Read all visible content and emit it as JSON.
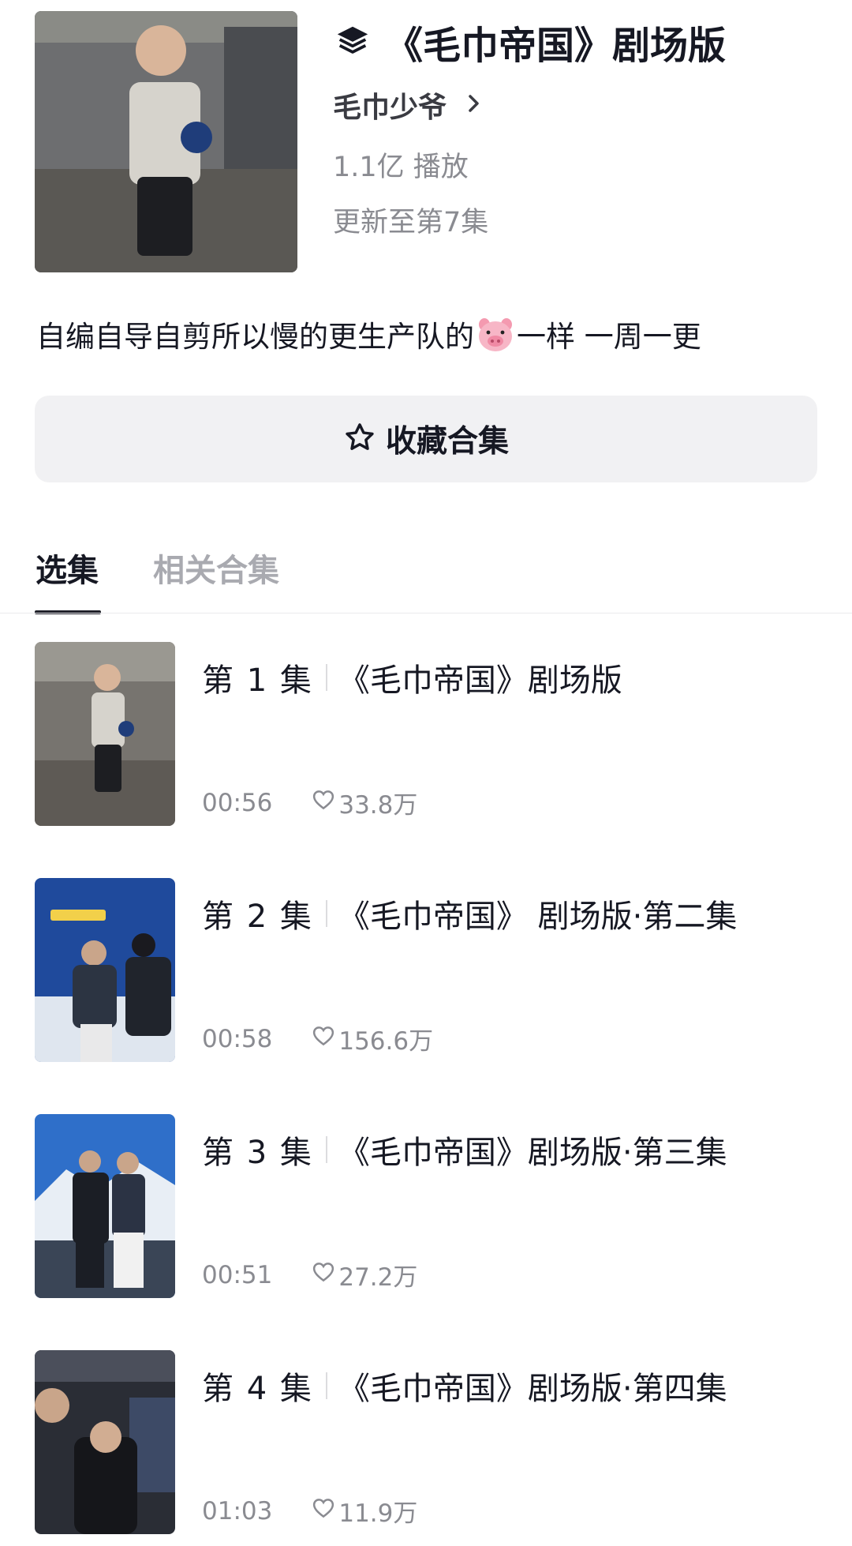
{
  "header": {
    "title": "《毛巾帝国》剧场版",
    "title_icon": "stack-layers-icon",
    "author": "毛巾少爷",
    "plays": "1.1亿 播放",
    "updated": "更新至第7集"
  },
  "description": {
    "before_emoji": "自编自导自剪所以慢的更生产队的",
    "emoji": "pig-face-emoji",
    "after_emoji": "一样 一周一更"
  },
  "collect_button": {
    "label": "收藏合集",
    "icon": "star-outline-icon"
  },
  "tabs": [
    {
      "label": "选集",
      "active": true
    },
    {
      "label": "相关合集",
      "active": false
    }
  ],
  "episodes": [
    {
      "number": "第 1 集",
      "title": "《毛巾帝国》剧场版",
      "duration": "00:56",
      "likes": "33.8万"
    },
    {
      "number": "第 2 集",
      "title": "《毛巾帝国》 剧场版·第二集",
      "duration": "00:58",
      "likes": "156.6万"
    },
    {
      "number": "第 3 集",
      "title": "《毛巾帝国》剧场版·第三集",
      "duration": "00:51",
      "likes": "27.2万"
    },
    {
      "number": "第 4 集",
      "title": "《毛巾帝国》剧场版·第四集",
      "duration": "01:03",
      "likes": "11.9万"
    }
  ],
  "colors": {
    "primary_text": "#161823",
    "secondary_text": "#8a8b91",
    "button_bg": "#f1f1f3",
    "tab_inactive": "#a9aab0"
  }
}
